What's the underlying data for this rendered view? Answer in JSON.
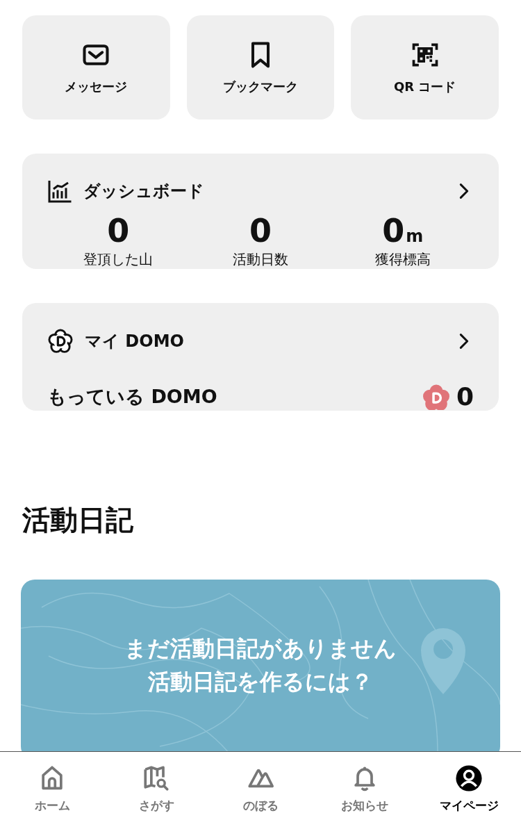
{
  "shortcuts": [
    {
      "label": "メッセージ"
    },
    {
      "label": "ブックマーク"
    },
    {
      "label": "QR コード"
    }
  ],
  "dashboard": {
    "title": "ダッシュボード",
    "stats": [
      {
        "value": "0",
        "label": "登頂した山"
      },
      {
        "value": "0",
        "label": "活動日数"
      },
      {
        "value": "0",
        "unit": "m",
        "label": "獲得標高"
      }
    ]
  },
  "my_domo": {
    "title": "マイ DOMO",
    "owned_label": "もっている DOMO",
    "owned_count": "0"
  },
  "diary": {
    "heading": "活動日記",
    "banner": {
      "kind": "picture",
      "lines": [
        "まだ活動日記がありません",
        "活動日記を作るには？"
      ]
    }
  },
  "tab_bar": [
    {
      "label": "ホーム",
      "selected": false
    },
    {
      "label": "さがす",
      "selected": false
    },
    {
      "label": "のぼる",
      "selected": false
    },
    {
      "label": "お知らせ",
      "selected": false
    },
    {
      "label": "マイページ",
      "selected": true
    }
  ]
}
